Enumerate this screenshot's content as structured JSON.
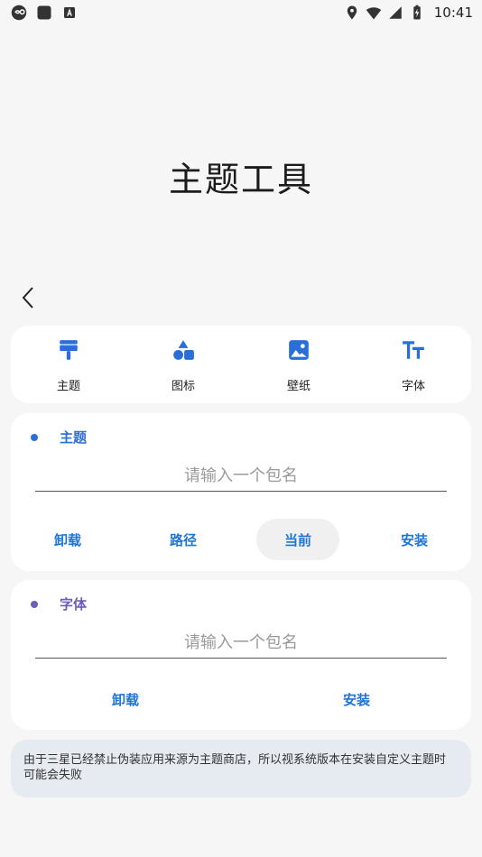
{
  "status_bar": {
    "time": "10:41",
    "left_icons": [
      "link-icon",
      "square-app-icon",
      "keyboard-a-icon"
    ],
    "right_icons": [
      "location-icon",
      "wifi-icon",
      "signal-icon",
      "battery-charging-icon"
    ]
  },
  "page": {
    "title": "主题工具"
  },
  "tabs": [
    {
      "label": "主题",
      "icon": "brush-icon"
    },
    {
      "label": "图标",
      "icon": "shapes-icon"
    },
    {
      "label": "壁纸",
      "icon": "image-icon"
    },
    {
      "label": "字体",
      "icon": "text-size-icon"
    }
  ],
  "theme_section": {
    "title": "主题",
    "input_placeholder": "请输入一个包名",
    "input_value": "",
    "actions": [
      "卸载",
      "路径",
      "当前",
      "安装"
    ]
  },
  "font_section": {
    "title": "字体",
    "input_placeholder": "请输入一个包名",
    "input_value": "",
    "actions": [
      "卸载",
      "安装"
    ]
  },
  "notice": "由于三星已经禁止伪装应用来源为主题商店，所以视系统版本在安装自定义主题时可能会失败",
  "colors": {
    "accent_blue": "#1f75d6",
    "icon_blue": "#2a6fd9",
    "theme_dot": "#2a6fd9",
    "font_accent": "#6a5fb8",
    "notice_bg": "#e6ebf1"
  }
}
